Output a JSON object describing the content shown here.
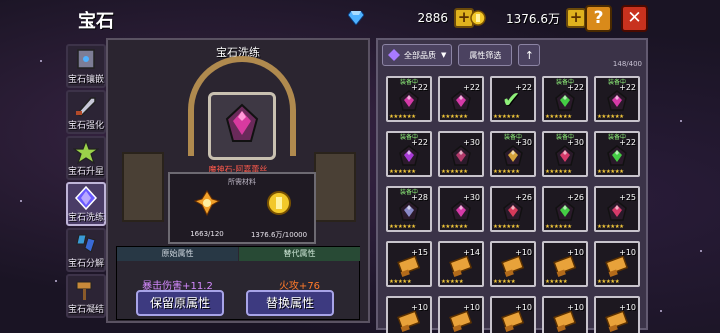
{
  "header": {
    "title": "宝石"
  },
  "currencies": {
    "diamonds": "2886",
    "gold": "1376.6万"
  },
  "buttons": {
    "help": "?",
    "close": "✕"
  },
  "side_tabs": [
    {
      "label": "宝石镶嵌",
      "active": false
    },
    {
      "label": "宝石强化",
      "active": false
    },
    {
      "label": "宝石升星",
      "active": false
    },
    {
      "label": "宝石洗练",
      "active": true
    },
    {
      "label": "宝石分解",
      "active": false
    },
    {
      "label": "宝石凝结",
      "active": false
    }
  ],
  "forge": {
    "title": "宝石洗练",
    "target_gem": "魔神石-阿嘉蕾丝",
    "materials_title": "所需材料",
    "material_1_count": "1663/120",
    "material_2_count": "1376.6万/10000",
    "original_header": "原始属性",
    "replace_header": "替代属性",
    "original_value": "暴击伤害+11.2",
    "replace_value": "火攻+76",
    "keep_button": "保留原属性",
    "replace_button": "替换属性"
  },
  "bag": {
    "quality_filter": "全部品质",
    "attr_filter": "属性筛选",
    "count": "148/400",
    "equipped_label": "装备中",
    "items": [
      {
        "lvl": "+22",
        "eq": true,
        "kind": "gem",
        "color": "#d63aa8",
        "stars": "★★★★★★"
      },
      {
        "lvl": "+22",
        "eq": false,
        "kind": "gem",
        "color": "#d63aa8",
        "stars": "★★★★★★"
      },
      {
        "lvl": "+22",
        "eq": false,
        "kind": "check",
        "color": "#66cc55",
        "stars": "★★★★★★"
      },
      {
        "lvl": "+22",
        "eq": true,
        "kind": "gem",
        "color": "#44cc44",
        "stars": "★★★★★★"
      },
      {
        "lvl": "+22",
        "eq": true,
        "kind": "gem",
        "color": "#d63aa8",
        "stars": "★★★★★★"
      },
      {
        "lvl": "+22",
        "eq": true,
        "kind": "gem",
        "color": "#a83ad6",
        "stars": "★★★★★★"
      },
      {
        "lvl": "+30",
        "eq": false,
        "kind": "gem",
        "color": "#b23a6a",
        "stars": "★★★★★★"
      },
      {
        "lvl": "+30",
        "eq": true,
        "kind": "gem",
        "color": "#d6a23a",
        "stars": "★★★★★★"
      },
      {
        "lvl": "+30",
        "eq": true,
        "kind": "gem",
        "color": "#d63a6a",
        "stars": "★★★★★★"
      },
      {
        "lvl": "+22",
        "eq": true,
        "kind": "gem",
        "color": "#44cc44",
        "stars": "★★★★★★"
      },
      {
        "lvl": "+28",
        "eq": true,
        "kind": "gem",
        "color": "#8a8ac8",
        "stars": "★★★★★★"
      },
      {
        "lvl": "+30",
        "eq": false,
        "kind": "gem",
        "color": "#d63aa8",
        "stars": "★★★★★★"
      },
      {
        "lvl": "+26",
        "eq": false,
        "kind": "gem",
        "color": "#d63a5a",
        "stars": "★★★★★★"
      },
      {
        "lvl": "+26",
        "eq": false,
        "kind": "gem",
        "color": "#44cc44",
        "stars": "★★★★★★"
      },
      {
        "lvl": "+25",
        "eq": false,
        "kind": "gem",
        "color": "#d63a6a",
        "stars": "★★★★★★"
      },
      {
        "lvl": "+15",
        "eq": false,
        "kind": "scroll",
        "color": "#e8a23a",
        "stars": "★★★★★"
      },
      {
        "lvl": "+14",
        "eq": false,
        "kind": "scroll",
        "color": "#e8a23a",
        "stars": "★★★★★"
      },
      {
        "lvl": "+10",
        "eq": false,
        "kind": "scroll",
        "color": "#e8a23a",
        "stars": "★★★★★"
      },
      {
        "lvl": "+10",
        "eq": false,
        "kind": "scroll",
        "color": "#e8a23a",
        "stars": "★★★★★"
      },
      {
        "lvl": "+10",
        "eq": false,
        "kind": "scroll",
        "color": "#e8a23a",
        "stars": "★★★★★"
      },
      {
        "lvl": "+10",
        "eq": false,
        "kind": "scroll",
        "color": "#e8a23a",
        "stars": ""
      },
      {
        "lvl": "+10",
        "eq": false,
        "kind": "scroll",
        "color": "#e8a23a",
        "stars": ""
      },
      {
        "lvl": "+10",
        "eq": false,
        "kind": "scroll",
        "color": "#e8a23a",
        "stars": ""
      },
      {
        "lvl": "+10",
        "eq": false,
        "kind": "scroll",
        "color": "#e8a23a",
        "stars": ""
      },
      {
        "lvl": "+10",
        "eq": false,
        "kind": "scroll",
        "color": "#e8a23a",
        "stars": ""
      }
    ]
  }
}
